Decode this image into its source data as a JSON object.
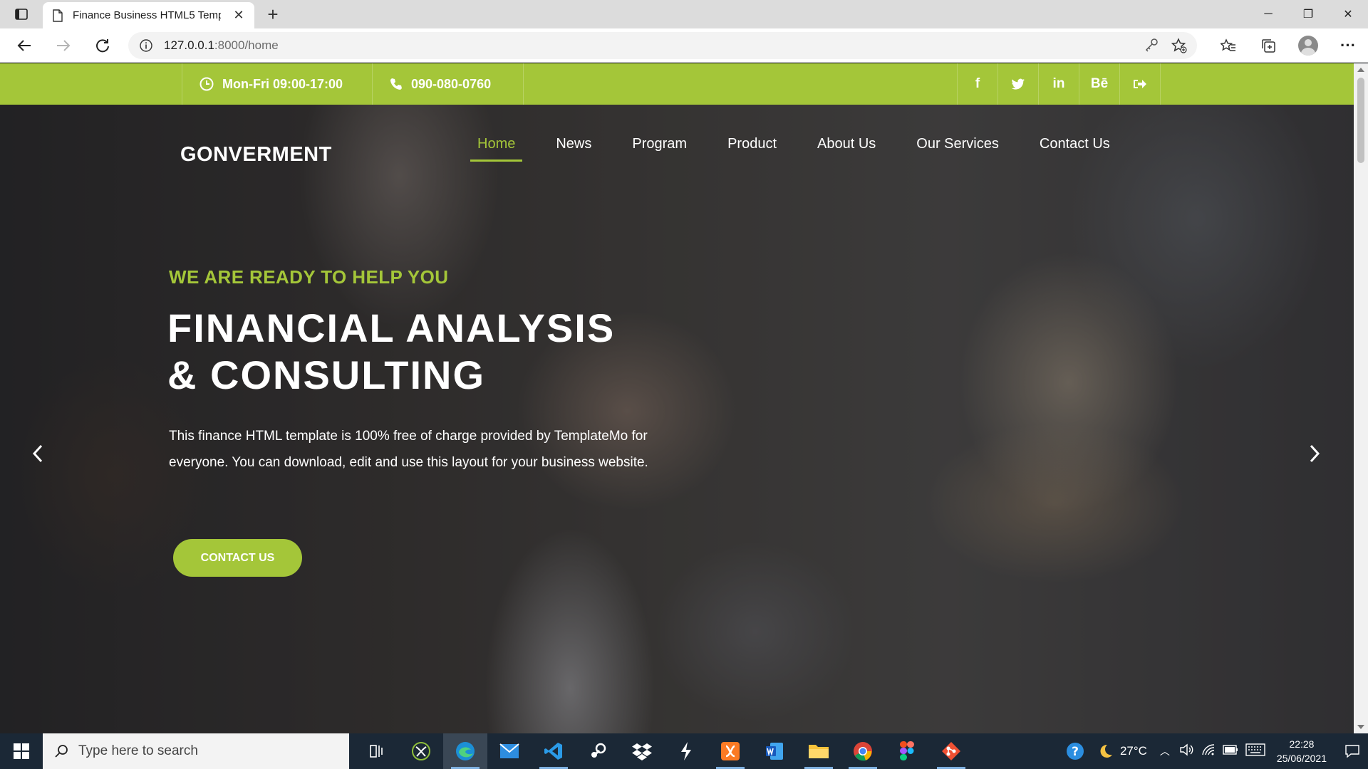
{
  "browser": {
    "tab_title": "Finance Business HTML5 Templat",
    "new_tab": "+",
    "url_host": "127.0.0.1",
    "url_rest": ":8000/home"
  },
  "topbar": {
    "hours": "Mon-Fri 09:00-17:00",
    "phone": "090-080-0760",
    "social": [
      "f",
      "t",
      "in",
      "Bē",
      "➜"
    ]
  },
  "site": {
    "brand": "GONVERMENT",
    "menu": [
      "Home",
      "News",
      "Program",
      "Product",
      "About Us",
      "Our Services",
      "Contact Us"
    ],
    "active_menu": "Home"
  },
  "hero": {
    "tagline": "WE ARE READY TO HELP YOU",
    "headline_line1": "FINANCIAL ANALYSIS",
    "headline_line2": "& CONSULTING",
    "description": "This finance HTML template is 100% free of charge provided by TemplateMo for everyone. You can download, edit and use this layout for your business website.",
    "cta_label": "CONTACT US"
  },
  "taskbar": {
    "search_placeholder": "Type here to search",
    "weather": "27°C",
    "time": "22:28",
    "date": "25/06/2021"
  },
  "colors": {
    "accent": "#a4c639",
    "taskbar": "#1b2836"
  }
}
